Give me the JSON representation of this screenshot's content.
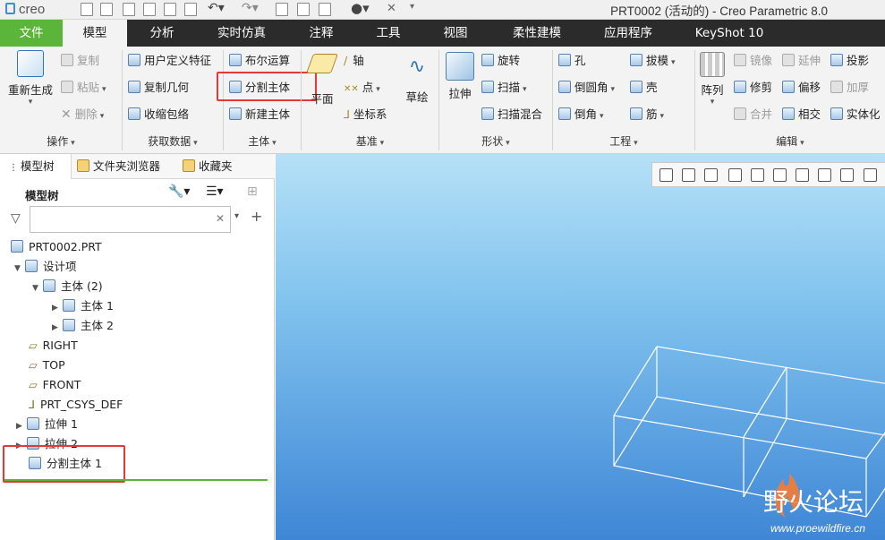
{
  "app": {
    "logo": "creo",
    "window_title": "PRT0002 (活动的) - Creo Parametric 8.0"
  },
  "tabs": [
    {
      "label": "文件"
    },
    {
      "label": "模型"
    },
    {
      "label": "分析"
    },
    {
      "label": "实时仿真"
    },
    {
      "label": "注释"
    },
    {
      "label": "工具"
    },
    {
      "label": "视图"
    },
    {
      "label": "柔性建模"
    },
    {
      "label": "应用程序"
    },
    {
      "label": "KeyShot 10"
    }
  ],
  "ribbon": {
    "groups": {
      "operation": "操作",
      "get_data": "获取数据",
      "body": "主体",
      "datum": "基准",
      "shape": "形状",
      "engineering": "工程",
      "edit": "编辑"
    },
    "regenerate": "重新生成",
    "copy": "复制",
    "paste": "粘贴",
    "delete": "删除",
    "user_defined_feature": "用户定义特征",
    "copy_geometry": "复制几何",
    "shrinkwrap": "收缩包络",
    "boolean": "布尔运算",
    "split_body": "分割主体",
    "new_body": "新建主体",
    "plane": "平面",
    "axis": "轴",
    "point": "点",
    "csys": "坐标系",
    "sketch": "草绘",
    "extrude": "拉伸",
    "revolve": "旋转",
    "sweep": "扫描",
    "swept_blend": "扫描混合",
    "hole": "孔",
    "round": "倒圆角",
    "chamfer": "倒角",
    "draft": "拔模",
    "shell": "壳",
    "rib": "筋",
    "pattern": "阵列",
    "mirror": "镜像",
    "trim": "修剪",
    "merge": "合并",
    "extend": "延伸",
    "offset": "偏移",
    "intersect": "相交",
    "project": "投影",
    "thicken": "加厚",
    "solidify": "实体化"
  },
  "panel": {
    "tabs": [
      {
        "label": "模型树"
      },
      {
        "label": "文件夹浏览器"
      },
      {
        "label": "收藏夹"
      }
    ],
    "tree_title": "模型树",
    "filter_placeholder": "",
    "nodes": [
      {
        "label": "PRT0002.PRT"
      },
      {
        "label": "设计项"
      },
      {
        "label": "主体 (2)"
      },
      {
        "label": "主体 1"
      },
      {
        "label": "主体 2"
      },
      {
        "label": "RIGHT"
      },
      {
        "label": "TOP"
      },
      {
        "label": "FRONT"
      },
      {
        "label": "PRT_CSYS_DEF"
      },
      {
        "label": "拉伸 1"
      },
      {
        "label": "拉伸 2"
      },
      {
        "label": "分割主体 1"
      }
    ]
  },
  "watermark": {
    "text": "野火论坛",
    "url": "www.proewildfire.cn"
  },
  "colors": {
    "file_tab": "#5bb53a",
    "highlight": "#e53935",
    "viewport_top": "#b6e1f7",
    "viewport_bottom": "#3f86d6"
  }
}
